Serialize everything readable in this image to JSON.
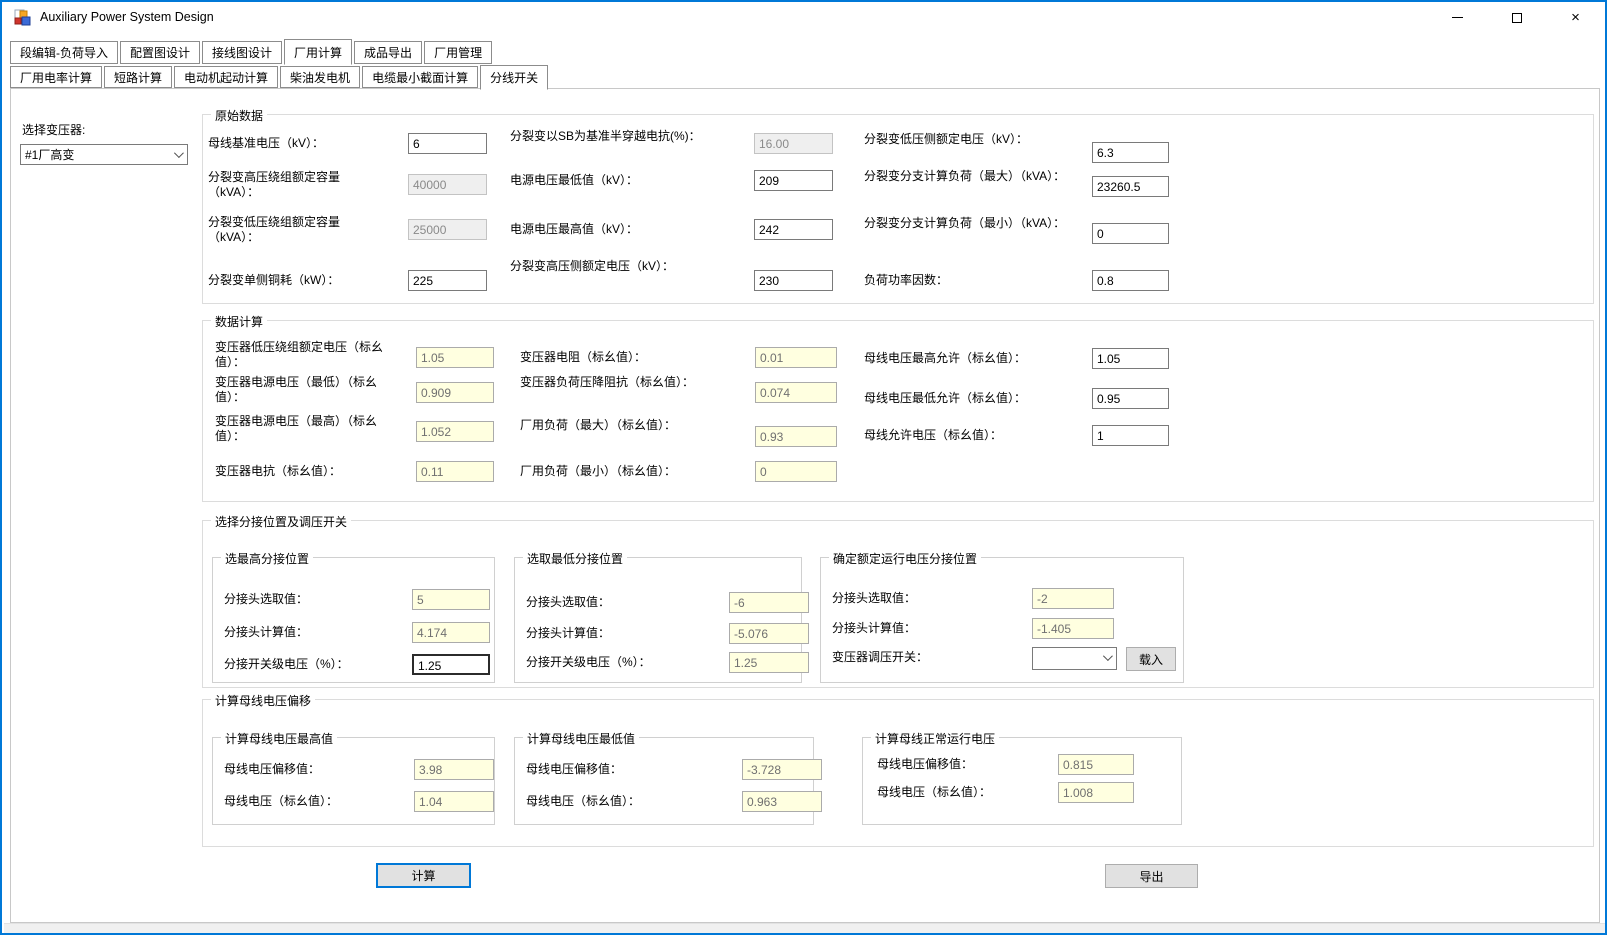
{
  "window": {
    "title": "Auxiliary Power System Design",
    "controls": {
      "minimize": "minimize-icon",
      "maximize": "maximize-icon",
      "close": "close-icon"
    }
  },
  "colors": {
    "accent": "#0078D7",
    "readonly_field_bg": "#FFFFE0",
    "disabled_field_bg": "#EFEFEF",
    "button_bg": "#E1E1E1"
  },
  "menu_tabs": [
    {
      "label": "段编辑-负荷导入",
      "selected": false
    },
    {
      "label": "配置图设计",
      "selected": false
    },
    {
      "label": "接线图设计",
      "selected": false
    },
    {
      "label": "厂用计算",
      "selected": true
    },
    {
      "label": "成品导出",
      "selected": false
    },
    {
      "label": "厂用管理",
      "selected": false
    }
  ],
  "sub_tabs": [
    {
      "label": "厂用电率计算",
      "selected": false
    },
    {
      "label": "短路计算",
      "selected": false
    },
    {
      "label": "电动机起动计算",
      "selected": false
    },
    {
      "label": "柴油发电机",
      "selected": false
    },
    {
      "label": "电缆最小截面计算",
      "selected": false
    },
    {
      "label": "分线开关",
      "selected": true
    }
  ],
  "sidebar": {
    "transformer_label": "选择变压器:",
    "transformer_value": "#1厂高变"
  },
  "original": {
    "title": "原始数据",
    "fields": [
      {
        "label": "母线基准电压（kV）：",
        "value": "6",
        "state": "editable"
      },
      {
        "label": "分裂变高压绕组额定容量（kVA）：",
        "value": "40000",
        "state": "disabled"
      },
      {
        "label": "分裂变低压绕组额定容量（kVA）：",
        "value": "25000",
        "state": "disabled"
      },
      {
        "label": "分裂变单侧铜耗（kW）：",
        "value": "225",
        "state": "editable"
      },
      {
        "label": "分裂变以SB为基准半穿越电抗(%)：",
        "value": "16.00",
        "state": "disabled"
      },
      {
        "label": "电源电压最低值（kV）：",
        "value": "209",
        "state": "editable"
      },
      {
        "label": "电源电压最高值（kV）：",
        "value": "242",
        "state": "editable"
      },
      {
        "label": "分裂变高压侧额定电压（kV）：",
        "value": "230",
        "state": "editable"
      },
      {
        "label": "分裂变低压侧额定电压（kV）：",
        "value": "6.3",
        "state": "editable"
      },
      {
        "label": "分裂变分支计算负荷（最大）（kVA）：",
        "value": "23260.5",
        "state": "editable"
      },
      {
        "label": "分裂变分支计算负荷（最小）（kVA）：",
        "value": "0",
        "state": "editable"
      },
      {
        "label": "负荷功率因数：",
        "value": "0.8",
        "state": "editable"
      }
    ]
  },
  "calc": {
    "title": "数据计算",
    "fields": [
      {
        "label": "变压器低压绕组额定电压（标幺值）：",
        "value": "1.05",
        "state": "readonly"
      },
      {
        "label": "变压器电源电压（最低）（标幺值）：",
        "value": "0.909",
        "state": "readonly"
      },
      {
        "label": "变压器电源电压（最高）（标幺值）：",
        "value": "1.052",
        "state": "readonly"
      },
      {
        "label": "变压器电抗（标幺值）：",
        "value": "0.11",
        "state": "readonly"
      },
      {
        "label": "变压器电阻（标幺值）：",
        "value": "0.01",
        "state": "readonly"
      },
      {
        "label": "变压器负荷压降阻抗（标幺值）：",
        "value": "0.074",
        "state": "readonly"
      },
      {
        "label": "厂用负荷（最大）（标幺值）：",
        "value": "0.93",
        "state": "readonly"
      },
      {
        "label": "厂用负荷（最小）（标幺值）：",
        "value": "0",
        "state": "readonly"
      },
      {
        "label": "母线电压最高允许（标幺值）：",
        "value": "1.05",
        "state": "editable"
      },
      {
        "label": "母线电压最低允许（标幺值）：",
        "value": "0.95",
        "state": "editable"
      },
      {
        "label": "母线允许电压（标幺值）：",
        "value": "1",
        "state": "editable"
      }
    ]
  },
  "tap": {
    "title": "选择分接位置及调压开关",
    "boxes": [
      {
        "title": "选最高分接位置",
        "fields": [
          {
            "label": "分接头选取值：",
            "value": "5",
            "state": "readonly"
          },
          {
            "label": "分接头计算值：",
            "value": "4.174",
            "state": "readonly"
          },
          {
            "label": "分接开关级电压（%）：",
            "value": "1.25",
            "state": "focused"
          }
        ]
      },
      {
        "title": "选取最低分接位置",
        "fields": [
          {
            "label": "分接头选取值：",
            "value": "-6",
            "state": "readonly"
          },
          {
            "label": "分接头计算值：",
            "value": "-5.076",
            "state": "readonly"
          },
          {
            "label": "分接开关级电压（%）：",
            "value": "1.25",
            "state": "readonly"
          }
        ]
      },
      {
        "title": "确定额定运行电压分接位置",
        "fields": [
          {
            "label": "分接头选取值：",
            "value": "-2",
            "state": "readonly"
          },
          {
            "label": "分接头计算值：",
            "value": "-1.405",
            "state": "readonly"
          },
          {
            "label": "变压器调压开关：",
            "value": "",
            "state": "combo"
          }
        ]
      }
    ]
  },
  "bus": {
    "title": "计算母线电压偏移",
    "boxes": [
      {
        "title": "计算母线电压最高值",
        "fields": [
          {
            "label": "母线电压偏移值：",
            "value": "3.98"
          },
          {
            "label": "母线电压（标幺值）：",
            "value": "1.04"
          }
        ]
      },
      {
        "title": "计算母线电压最低值",
        "fields": [
          {
            "label": "母线电压偏移值：",
            "value": "-3.728"
          },
          {
            "label": "母线电压（标幺值）：",
            "value": "0.963"
          }
        ]
      },
      {
        "title": "计算母线正常运行电压",
        "fields": [
          {
            "label": "母线电压偏移值：",
            "value": "0.815"
          },
          {
            "label": "母线电压（标幺值）：",
            "value": "1.008"
          }
        ]
      }
    ]
  },
  "buttons": {
    "calculate": "计算",
    "export": "导出",
    "load": "载入"
  }
}
